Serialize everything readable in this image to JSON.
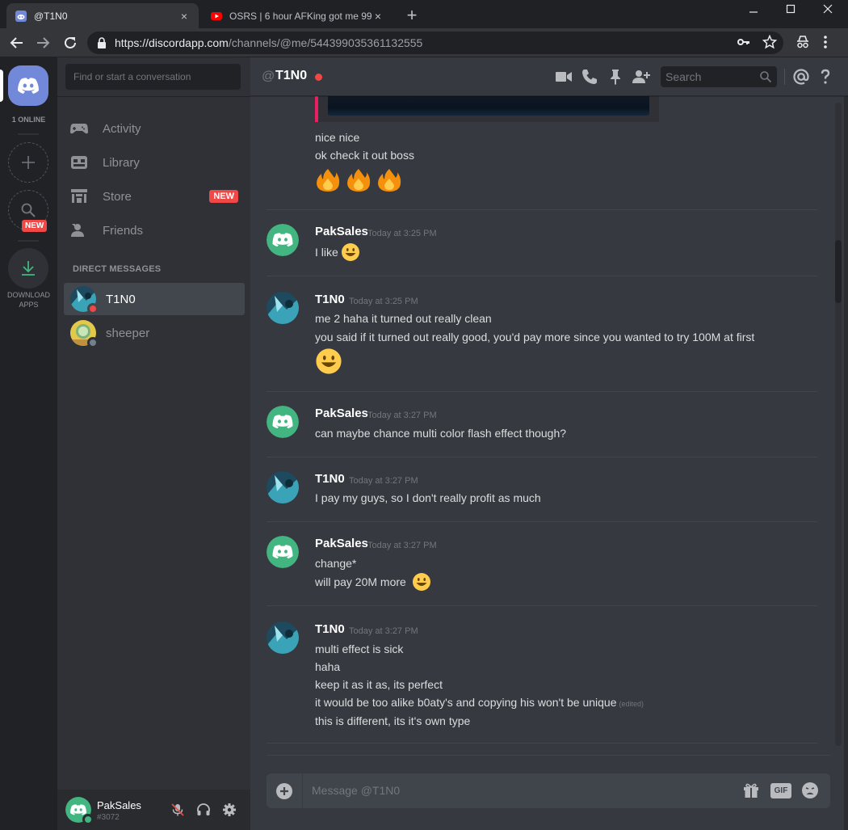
{
  "browser": {
    "tabs": [
      {
        "title": "@T1N0",
        "close": "×"
      },
      {
        "title": "OSRS | 6 hour AFKing got me 99",
        "close": "×"
      }
    ],
    "new_tab": "+",
    "url_host": "https://discordapp.com",
    "url_path": "/channels/@me/544399035361132555"
  },
  "guilds": {
    "online_count": "1 ONLINE",
    "new_badge": "NEW",
    "download_line1": "DOWNLOAD",
    "download_line2": "APPS"
  },
  "sidebar": {
    "search_placeholder": "Find or start a conversation",
    "nav": [
      {
        "label": "Activity"
      },
      {
        "label": "Library"
      },
      {
        "label": "Store",
        "badge": "NEW"
      },
      {
        "label": "Friends"
      }
    ],
    "dm_header": "DIRECT MESSAGES",
    "dms": [
      {
        "name": "T1N0",
        "status": "dnd"
      },
      {
        "name": "sheeper",
        "status": "offline"
      }
    ]
  },
  "user": {
    "name": "PakSales",
    "tag": "#3072"
  },
  "header": {
    "at": "@",
    "channel": "T1N0",
    "search_placeholder": "Search"
  },
  "messages": {
    "prev": [
      "nice nice",
      "ok check it out boss"
    ],
    "groups": [
      {
        "author": "PakSales",
        "time": "Today at 3:25 PM",
        "lines": [
          "I like"
        ]
      },
      {
        "author": "T1N0",
        "time": "Today at 3:25 PM",
        "lines": [
          "me 2 haha it turned out really clean",
          "you said if it turned out really good, you'd pay more since you wanted to try 100M at first"
        ]
      },
      {
        "author": "PakSales",
        "time": "Today at 3:27 PM",
        "lines": [
          "can maybe chance multi color flash effect though?"
        ]
      },
      {
        "author": "T1N0",
        "time": "Today at 3:27 PM",
        "lines": [
          "I pay my guys, so I don't really profit as much"
        ]
      },
      {
        "author": "PakSales",
        "time": "Today at 3:27 PM",
        "lines": [
          "change*",
          "will pay 20M more"
        ]
      },
      {
        "author": "T1N0",
        "time": "Today at 3:27 PM",
        "lines": [
          "multi effect is sick",
          "haha",
          "keep it as it as, its perfect",
          "it would be too alike b0aty's and copying his won't be unique",
          "this is different, its it's own type"
        ],
        "edited": "(edited)"
      }
    ]
  },
  "composer": {
    "placeholder": "Message @T1N0",
    "gif": "GIF"
  },
  "colors": {
    "blurple": "#7289da",
    "dnd": "#f04747",
    "online": "#43b581",
    "offline": "#747f8d",
    "bg": "#36393f"
  }
}
